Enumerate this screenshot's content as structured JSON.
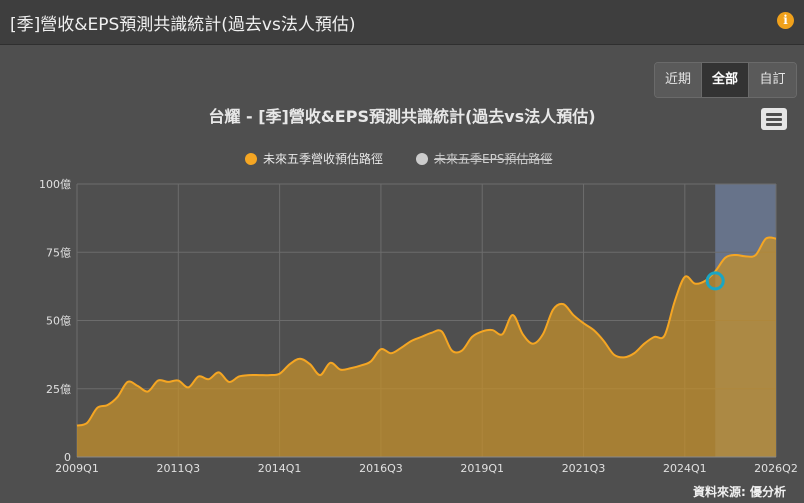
{
  "header": {
    "title": "[季]營收&EPS預測共識統計(過去vs法人預估)",
    "info_icon": "info-icon"
  },
  "range_buttons": [
    {
      "label": "近期",
      "active": false
    },
    {
      "label": "全部",
      "active": true
    },
    {
      "label": "自訂",
      "active": false
    }
  ],
  "menu_icon": "hamburger-menu-icon",
  "credit": "資料來源: 優分析",
  "colors": {
    "area": "#c8922a",
    "line": "#f5a623",
    "forecast_band": "#6f7f9e",
    "marker": "#1aa6c4",
    "legend_hidden": "#cccccc"
  },
  "chart_data": {
    "type": "area",
    "title": "台耀 - [季]營收&EPS預測共識統計(過去vs法人預估)",
    "legend": [
      {
        "name": "未來五季營收預估路徑",
        "color": "#f5a623",
        "visible": true
      },
      {
        "name": "未來五季EPS預估路徑",
        "color": "#cccccc",
        "visible": false
      }
    ],
    "legend_position": "top-center",
    "y_unit": "億",
    "ylim": [
      0,
      100
    ],
    "y_ticks": [
      {
        "value": 0,
        "label": "0"
      },
      {
        "value": 25,
        "label": "25億"
      },
      {
        "value": 50,
        "label": "50億"
      },
      {
        "value": 75,
        "label": "75億"
      },
      {
        "value": 100,
        "label": "100億"
      }
    ],
    "x_tick_labels": [
      "2009Q1",
      "2011Q3",
      "2014Q1",
      "2016Q3",
      "2019Q1",
      "2021Q3",
      "2024Q1",
      "2026Q2"
    ],
    "grid": true,
    "forecast_start": "2024Q4",
    "highlight_point": {
      "x": "2024Q4",
      "y": 64.5
    },
    "series": [
      {
        "name": "未來五季營收預估路徑",
        "x": [
          "2009Q1",
          "2009Q2",
          "2009Q3",
          "2009Q4",
          "2010Q1",
          "2010Q2",
          "2010Q3",
          "2010Q4",
          "2011Q1",
          "2011Q2",
          "2011Q3",
          "2011Q4",
          "2012Q1",
          "2012Q2",
          "2012Q3",
          "2012Q4",
          "2013Q1",
          "2013Q2",
          "2013Q3",
          "2013Q4",
          "2014Q1",
          "2014Q2",
          "2014Q3",
          "2014Q4",
          "2015Q1",
          "2015Q2",
          "2015Q3",
          "2015Q4",
          "2016Q1",
          "2016Q2",
          "2016Q3",
          "2016Q4",
          "2017Q1",
          "2017Q2",
          "2017Q3",
          "2017Q4",
          "2018Q1",
          "2018Q2",
          "2018Q3",
          "2018Q4",
          "2019Q1",
          "2019Q2",
          "2019Q3",
          "2019Q4",
          "2020Q1",
          "2020Q2",
          "2020Q3",
          "2020Q4",
          "2021Q1",
          "2021Q2",
          "2021Q3",
          "2021Q4",
          "2022Q1",
          "2022Q2",
          "2022Q3",
          "2022Q4",
          "2023Q1",
          "2023Q2",
          "2023Q3",
          "2023Q4",
          "2024Q1",
          "2024Q2",
          "2024Q3",
          "2024Q4",
          "2025Q1",
          "2025Q2",
          "2025Q3",
          "2025Q4",
          "2026Q1",
          "2026Q2"
        ],
        "values": [
          11.5,
          12.5,
          18,
          19,
          22,
          27.5,
          26,
          24,
          28,
          27.5,
          28,
          25.5,
          29.5,
          28.5,
          31,
          27.5,
          29.5,
          30,
          30,
          30,
          30.5,
          34,
          36,
          34,
          30,
          34.5,
          32,
          32.5,
          33.5,
          35,
          39.5,
          38,
          40,
          42.5,
          44,
          45.5,
          46,
          39,
          39,
          44,
          46,
          46.5,
          45,
          52,
          45,
          41.5,
          45,
          54,
          56,
          52,
          49,
          46.5,
          42.5,
          37.5,
          36.5,
          38,
          41.5,
          44,
          44.5,
          57,
          66,
          63.5,
          64.5,
          68,
          73,
          74,
          73.5,
          74,
          80,
          80
        ]
      }
    ]
  }
}
